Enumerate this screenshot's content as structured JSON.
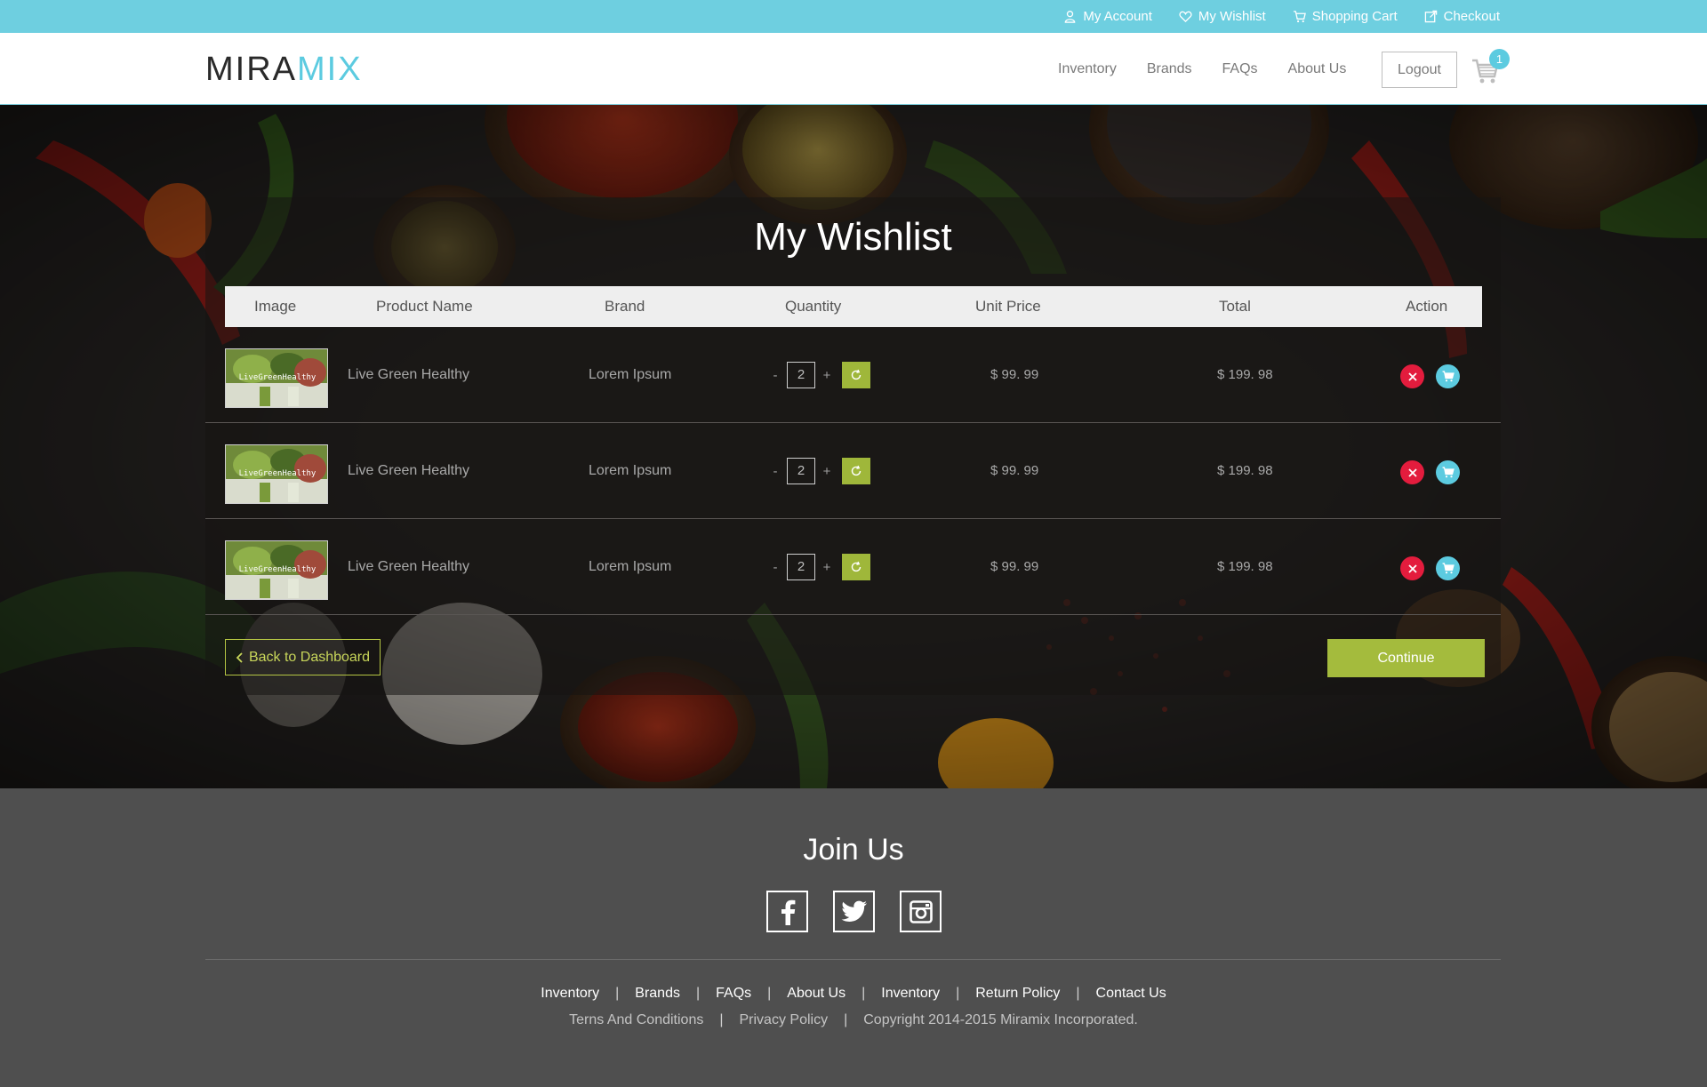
{
  "topbar": {
    "links": [
      {
        "label": "My Account",
        "icon": "user-icon"
      },
      {
        "label": "My Wishlist",
        "icon": "heart-icon"
      },
      {
        "label": "Shopping Cart",
        "icon": "cart-icon"
      },
      {
        "label": "Checkout",
        "icon": "checkout-icon"
      }
    ]
  },
  "header": {
    "logo_part1": "MIRA",
    "logo_part2": "MIX",
    "nav": [
      "Inventory",
      "Brands",
      "FAQs",
      "About Us"
    ],
    "logout_label": "Logout",
    "cart_count": "1"
  },
  "colors": {
    "accent_blue": "#6ecfe0",
    "accent_green": "#a4bb3d",
    "remove_red": "#e31c3d"
  },
  "wishlist": {
    "title": "My Wishlist",
    "columns": [
      "Image",
      "Product Name",
      "Brand",
      "Quantity",
      "Unit Price",
      "Total",
      "Action"
    ],
    "image_text": "LiveGreenHealthy",
    "qty_minus": "-",
    "qty_plus": "+",
    "rows": [
      {
        "product": "Live Green Healthy",
        "brand": "Lorem Ipsum",
        "quantity": "2",
        "unit_price": "$ 99. 99",
        "total": "$ 199. 98"
      },
      {
        "product": "Live Green Healthy",
        "brand": "Lorem Ipsum",
        "quantity": "2",
        "unit_price": "$ 99. 99",
        "total": "$ 199. 98"
      },
      {
        "product": "Live Green Healthy",
        "brand": "Lorem Ipsum",
        "quantity": "2",
        "unit_price": "$ 99. 99",
        "total": "$ 199. 98"
      }
    ],
    "back_label": "Back to Dashboard",
    "continue_label": "Continue"
  },
  "footer": {
    "join_title": "Join Us",
    "socials": [
      "facebook-icon",
      "twitter-icon",
      "instagram-icon"
    ],
    "links": [
      "Inventory",
      "Brands",
      "FAQs",
      "About Us",
      "Inventory",
      "Return Policy",
      "Contact Us"
    ],
    "terms": "Terns And Conditions",
    "privacy": "Privacy Policy",
    "copyright": "Copyright 2014-2015 Miramix Incorporated."
  }
}
